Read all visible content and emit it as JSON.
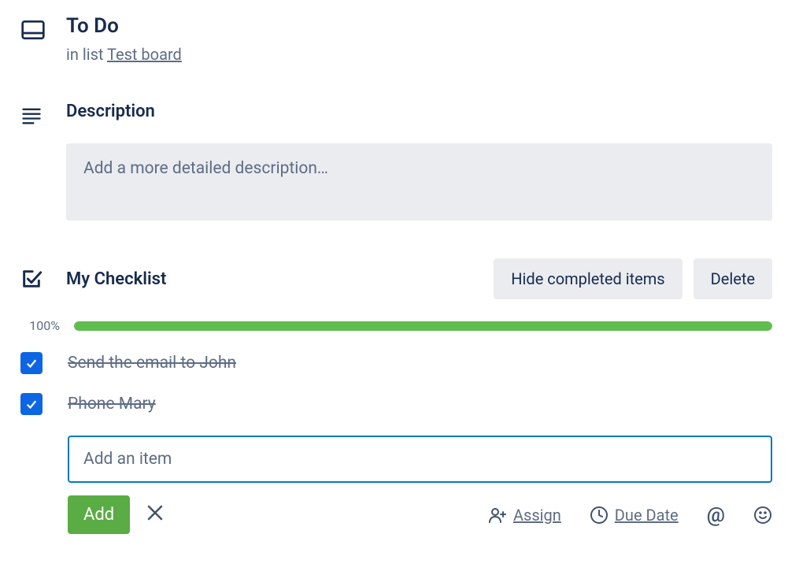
{
  "header": {
    "title": "To Do",
    "subtitle_prefix": "in list ",
    "list_name": "Test board"
  },
  "description": {
    "section_label": "Description",
    "placeholder": "Add a more detailed description…"
  },
  "checklist": {
    "title": "My Checklist",
    "hide_completed_label": "Hide completed items",
    "delete_label": "Delete",
    "progress_percent": "100%",
    "progress_value": 100,
    "items": [
      {
        "text": "Send the email to John",
        "checked": true
      },
      {
        "text": "Phone Mary",
        "checked": true
      }
    ],
    "add_item_placeholder": "Add an item",
    "add_button_label": "Add",
    "assign_label": "Assign",
    "due_date_label": "Due Date"
  }
}
